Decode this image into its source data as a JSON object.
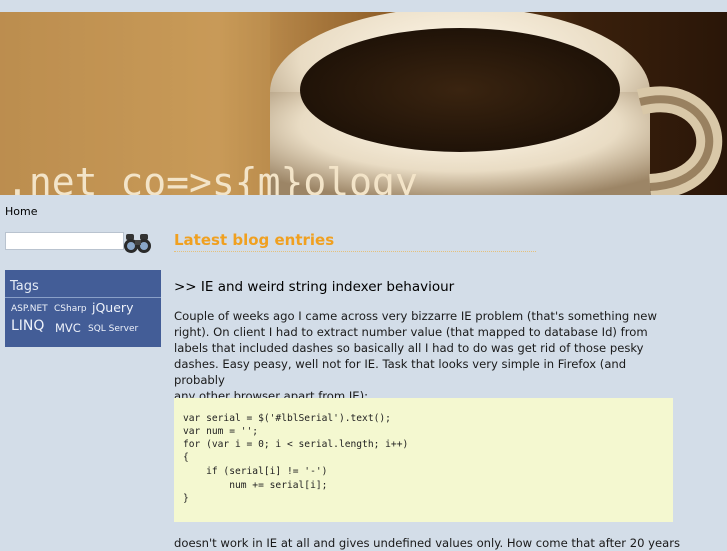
{
  "site": {
    "title": ".net co=>s{m}ology"
  },
  "nav": {
    "home_label": "Home"
  },
  "search": {
    "placeholder": "",
    "value": "",
    "button_icon": "binoculars-icon"
  },
  "tags": {
    "title": "Tags",
    "items": [
      {
        "label": "ASP.NET"
      },
      {
        "label": "CSharp"
      },
      {
        "label": "jQuery"
      },
      {
        "label": "LINQ"
      },
      {
        "label": "MVC"
      },
      {
        "label": "SQL Server"
      }
    ]
  },
  "main": {
    "section_title": "Latest blog entries",
    "post": {
      "title": ">> IE and weird string indexer behaviour",
      "paragraph_lines": [
        "Couple of weeks ago I came across very bizzarre IE problem (that's something new",
        "right). On client I had to extract number value (that mapped to database Id) from",
        "labels that included dashes so basically all I had to do was get rid of those pesky",
        "dashes. Easy peasy, well not for IE. Task that looks very simple in Firefox (and probably",
        "any other browser apart from IE):"
      ],
      "code_lines": [
        "var serial = $('#lblSerial').text();",
        "var num = '';",
        "for (var i = 0; i < serial.length; i++)",
        "{",
        "    if (serial[i] != '-')",
        "        num += serial[i];",
        "}"
      ],
      "after_code": "doesn't work in IE at all and gives undefined values only. How come that after 20 years"
    }
  },
  "colors": {
    "page_bg": "#d3dde8",
    "accent_orange": "#f0a020",
    "tags_bg": "#435d97",
    "code_bg": "#f4f8d0"
  }
}
